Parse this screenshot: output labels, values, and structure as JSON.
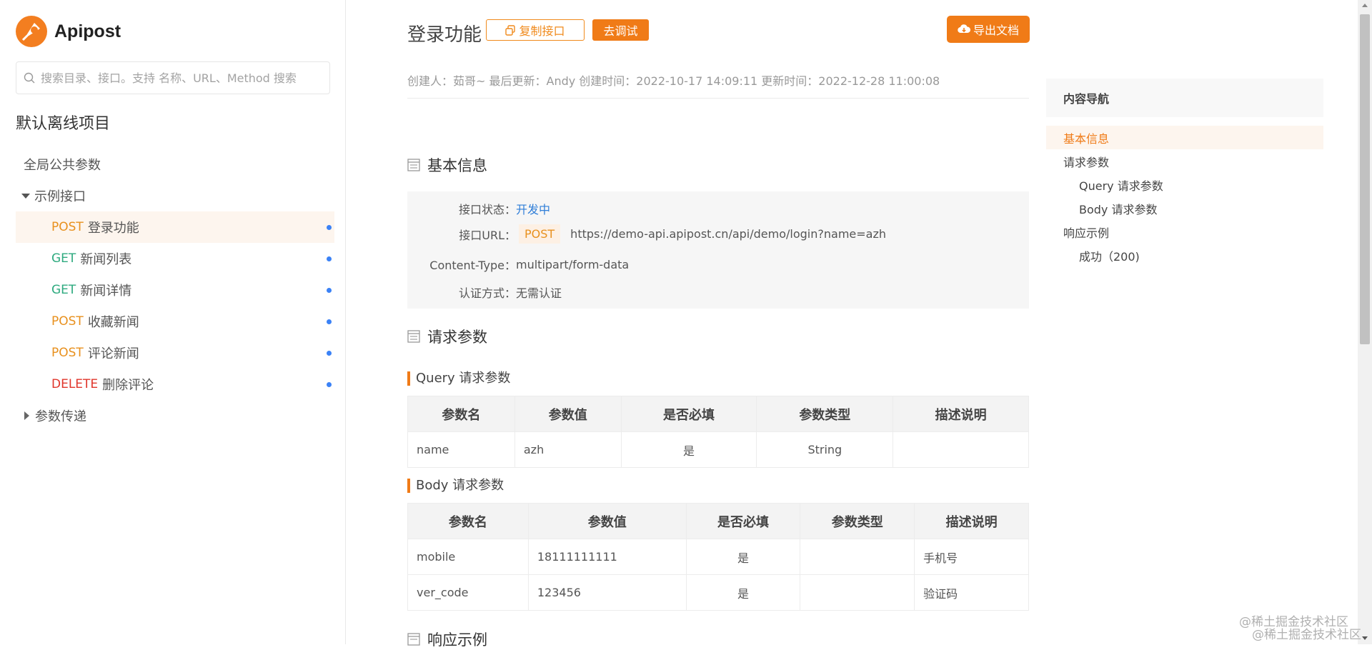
{
  "brand": {
    "name": "Apipost"
  },
  "search": {
    "placeholder": "搜索目录、接口。支持 名称、URL、Method 搜索"
  },
  "project_title": "默认离线项目",
  "tree": {
    "global_params": "全局公共参数",
    "example_folder": "示例接口",
    "items": [
      {
        "method": "POST",
        "label": "登录功能"
      },
      {
        "method": "GET",
        "label": "新闻列表"
      },
      {
        "method": "GET",
        "label": "新闻详情"
      },
      {
        "method": "POST",
        "label": "收藏新闻"
      },
      {
        "method": "POST",
        "label": "评论新闻"
      },
      {
        "method": "DELETE",
        "label": "删除评论"
      }
    ],
    "param_folder": "参数传递"
  },
  "header": {
    "title": "登录功能",
    "copy_btn": "复制接口",
    "debug_btn": "去调试",
    "export_btn": "导出文档"
  },
  "meta": {
    "text": "创建人：茹哥~ 最后更新：Andy 创建时间：2022-10-17 14:09:11   更新时间：2022-12-28 11:00:08"
  },
  "basic": {
    "heading": "基本信息",
    "status_label": "接口状态：",
    "status_value": "开发中",
    "url_label": "接口URL：",
    "url_method": "POST",
    "url_value": "https://demo-api.apipost.cn/api/demo/login?name=azh",
    "ctype_label": "Content-Type：",
    "ctype_value": "multipart/form-data",
    "auth_label": "认证方式：",
    "auth_value": "无需认证"
  },
  "request": {
    "heading": "请求参数",
    "query": {
      "heading": "Query 请求参数",
      "columns": [
        "参数名",
        "参数值",
        "是否必填",
        "参数类型",
        "描述说明"
      ],
      "rows": [
        [
          "name",
          "azh",
          "是",
          "String",
          ""
        ]
      ]
    },
    "body": {
      "heading": "Body 请求参数",
      "columns": [
        "参数名",
        "参数值",
        "是否必填",
        "参数类型",
        "描述说明"
      ],
      "rows": [
        [
          "mobile",
          "18111111111",
          "是",
          "",
          "手机号"
        ],
        [
          "ver_code",
          "123456",
          "是",
          "",
          "验证码"
        ]
      ]
    }
  },
  "response": {
    "heading": "响应示例"
  },
  "toc": {
    "title": "内容导航",
    "items": [
      {
        "label": "基本信息",
        "level": 0,
        "active": true
      },
      {
        "label": "请求参数",
        "level": 0,
        "active": false
      },
      {
        "label": "Query 请求参数",
        "level": 1,
        "active": false
      },
      {
        "label": "Body 请求参数",
        "level": 1,
        "active": false
      },
      {
        "label": "响应示例",
        "level": 0,
        "active": false
      },
      {
        "label": "成功（200)",
        "level": 1,
        "active": false
      }
    ]
  },
  "watermark": {
    "text": "@稀土掘金技术社区"
  },
  "colors": {
    "accent": "#f07b17",
    "get": "#2eaa7f",
    "delete": "#e0352b",
    "link": "#2f7ed8"
  }
}
